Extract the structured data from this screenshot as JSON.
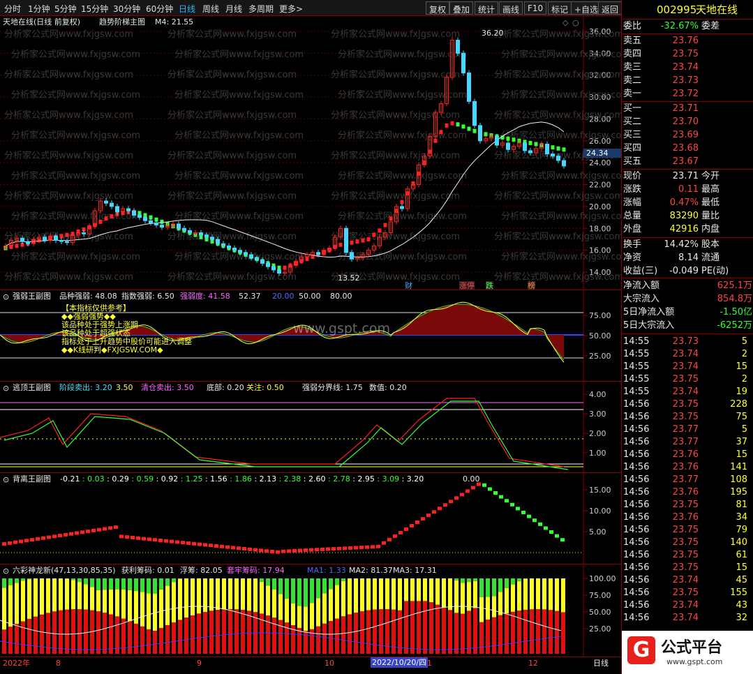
{
  "periods": [
    "分时",
    "1分钟",
    "5分钟",
    "15分钟",
    "30分钟",
    "60分钟",
    "日线",
    "周线",
    "月线",
    "多周期",
    "更多>"
  ],
  "toolbar": [
    "复权",
    "叠加",
    "统计",
    "画线",
    "F10",
    "标记",
    "+自选",
    "返回"
  ],
  "stock": {
    "code": "002995",
    "name": "天地在线"
  },
  "main": {
    "title": "天地在线(日线 前复权)",
    "indicator": "趋势阶梯主图",
    "m4": "M4: 21.55",
    "high_label": "36.20",
    "low_label": "13.52",
    "price_tag": "24.34",
    "axis": [
      "36.00",
      "34.00",
      "32.00",
      "30.00",
      "28.00",
      "26.00",
      "24.00",
      "22.00",
      "20.00",
      "18.00",
      "16.00",
      "14.00"
    ],
    "events": [
      "财",
      "涨停",
      "跌",
      "榜"
    ],
    "watermark": "分析家公式网www.fxjgsw.com"
  },
  "sub1": {
    "name": "强弱王副图",
    "items": [
      "品种强弱: 48.08",
      "指数强弱: 6.50",
      "强弱度: 41.58",
      "52.37",
      "20.00",
      "50.00",
      "80.00"
    ],
    "notes": [
      "【本指标仅供参考】",
      "◆◆强弱强势◆◆",
      "该品种处于强势上涨期",
      "该品种处于超强状态",
      "指标处于上升趋势中股价可能进入调整",
      "◆◆K线研判◆FXJGSW.COM◆"
    ],
    "axis": [
      "75.00",
      "50.00",
      "25.00"
    ],
    "wm": "www.gspt.com"
  },
  "sub2": {
    "name": "逃顶王副图",
    "items": [
      "阶段卖出: 3.20",
      "3.50",
      "清仓卖出: 3.50",
      "底部: 0.20",
      "关注: 0.50",
      "强弱分界线: 1.75",
      "数值: 0.20"
    ],
    "axis": [
      "4.00",
      "3.00",
      "2.00",
      "1.00"
    ]
  },
  "sub3": {
    "name": "背离王副图",
    "items": [
      "-0.21",
      "0.03",
      "0.29",
      "0.59",
      "0.92",
      "1.25",
      "1.56",
      "1.86",
      "2.13",
      "2.38",
      "2.60",
      "2.78",
      "2.95",
      "3.09",
      "3.20"
    ],
    "zero": "0.00",
    "axis": [
      "15.00",
      "10.00",
      "5.00"
    ]
  },
  "sub4": {
    "name": "六彩神龙新(47,13,30,85,35)",
    "items": [
      "获利筹码: 0.01",
      "浮筹: 82.05",
      "套牢筹码: 17.94",
      "MA1: 1.33",
      "MA2: 81.37",
      "MA3: 17.31"
    ],
    "axis": [
      "100.00",
      "75.00",
      "50.00",
      "25.00"
    ]
  },
  "xaxis": [
    "2022年",
    "8",
    "9",
    "10",
    "2022/10/20/四",
    "1",
    "12",
    "日线"
  ],
  "quote": {
    "wb": [
      "委比",
      "-32.67%",
      "委差"
    ],
    "sell": [
      [
        "卖五",
        "23.76"
      ],
      [
        "卖四",
        "23.75"
      ],
      [
        "卖三",
        "23.74"
      ],
      [
        "卖二",
        "23.73"
      ],
      [
        "卖一",
        "23.72"
      ]
    ],
    "buy": [
      [
        "买一",
        "23.71"
      ],
      [
        "买二",
        "23.70"
      ],
      [
        "买三",
        "23.69"
      ],
      [
        "买四",
        "23.68"
      ],
      [
        "买五",
        "23.67"
      ]
    ],
    "stats": [
      [
        "现价",
        "23.71",
        "今开"
      ],
      [
        "涨跌",
        "0.11",
        "最高"
      ],
      [
        "涨幅",
        "0.47%",
        "最低"
      ],
      [
        "总量",
        "83290",
        "量比"
      ],
      [
        "外盘",
        "42916",
        "内盘"
      ],
      [
        "换手",
        "14.42%",
        "股本"
      ],
      [
        "净资",
        "8.14",
        "流通"
      ],
      [
        "收益(三)",
        "-0.049",
        "PE(动)"
      ]
    ],
    "flows": [
      [
        "净流入额",
        "625.1万"
      ],
      [
        "大宗流入",
        "854.8万"
      ],
      [
        "5日净流入额",
        "-1.50亿"
      ],
      [
        "5日大宗流入",
        "-6252万"
      ]
    ]
  },
  "ticks": [
    [
      "14:55",
      "23.73",
      "5"
    ],
    [
      "14:55",
      "23.74",
      "2"
    ],
    [
      "14:55",
      "23.74",
      "15"
    ],
    [
      "14:55",
      "23.75",
      "2"
    ],
    [
      "14:55",
      "23.74",
      "19"
    ],
    [
      "14:56",
      "23.75",
      "228"
    ],
    [
      "14:56",
      "23.75",
      "75"
    ],
    [
      "14:56",
      "23.77",
      "5"
    ],
    [
      "14:56",
      "23.77",
      "37"
    ],
    [
      "14:56",
      "23.76",
      "15"
    ],
    [
      "14:56",
      "23.76",
      "141"
    ],
    [
      "14:56",
      "23.77",
      "108"
    ],
    [
      "14:56",
      "23.76",
      "195"
    ],
    [
      "14:56",
      "23.75",
      "81"
    ],
    [
      "14:56",
      "23.76",
      "34"
    ],
    [
      "14:56",
      "23.75",
      "79"
    ],
    [
      "14:56",
      "23.75",
      "140"
    ],
    [
      "14:56",
      "23.75",
      "61"
    ],
    [
      "14:56",
      "23.75",
      "15"
    ],
    [
      "14:56",
      "23.74",
      "45"
    ],
    [
      "14:56",
      "23.75",
      "155"
    ],
    [
      "14:56",
      "23.74",
      "43"
    ],
    [
      "14:56",
      "23.74",
      "32"
    ]
  ],
  "brand": {
    "text": "公式平台",
    "url": "www.gspt.com"
  },
  "colors": {
    "up": "#ff2020",
    "down": "#33ff33",
    "cyan": "#44d8ff",
    "frame": "#8a0000",
    "yellow": "#ffff33"
  }
}
